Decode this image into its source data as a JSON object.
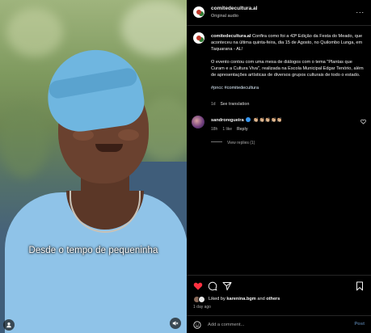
{
  "video": {
    "caption": "Desde o tempo de pequeninha"
  },
  "header": {
    "username": "comitedecultura.al",
    "subtitle": "Original audio",
    "more_label": "..."
  },
  "post": {
    "username": "comitedecultura.al",
    "caption_p1": "Confira como foi a 43ª Edição da Festa do Meado, que aconteceu na última quinta-feira, dia 15 de Agosto, no Quilombo Lunga, em Taquarana - AL!",
    "caption_p2": "O evento contou com uma mesa de diálogos com o tema \"Plantas que Curam e a Cultura Viva\", realizada na Escola Municipal Edgar Tenório, além de apresentações artísticas de diversos grupos culturais de todo o estado.",
    "hashtags": "#pncc #comitedecultura",
    "age": "1d",
    "see_translation": "See translation"
  },
  "comment": {
    "username": "sandroregueira",
    "text": "👏🏼👏🏼👏🏼👏🏼👏🏼",
    "age": "18h",
    "likes": "1 like",
    "reply": "Reply",
    "view_replies": "View replies (1)"
  },
  "likes": {
    "prefix": "Liked by ",
    "user": "karenina.bgm",
    "and": " and ",
    "others": "others"
  },
  "timestamp": "1 day ago",
  "add_comment": {
    "placeholder": "Add a comment...",
    "post_label": "Post"
  },
  "colors": {
    "like_active": "#ff3040",
    "verified": "#3897f0",
    "post_button": "#4d6f93"
  }
}
